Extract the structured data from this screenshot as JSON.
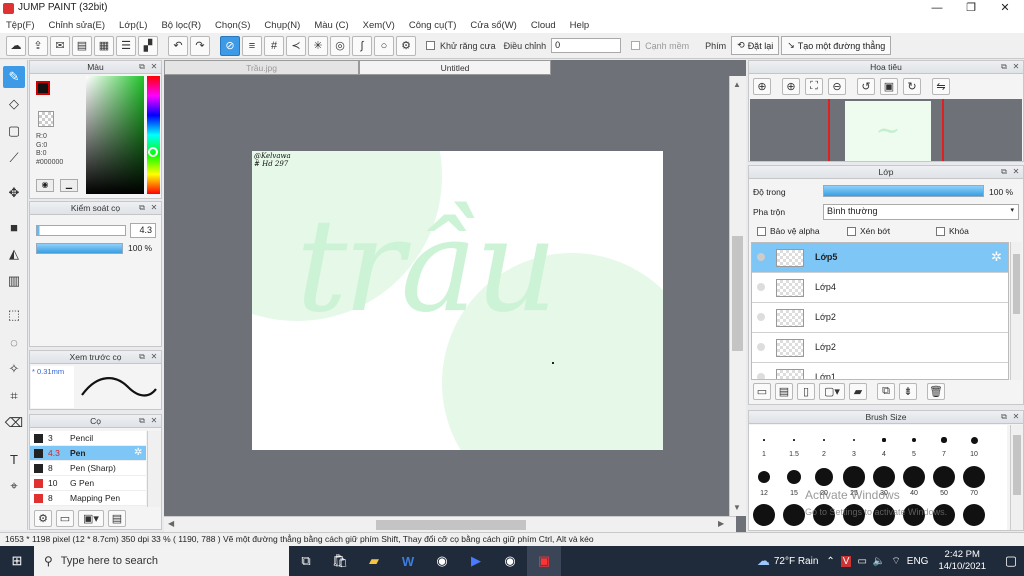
{
  "window": {
    "title": "JUMP PAINT (32bit)",
    "minimize": "—",
    "maximize": "❐",
    "close": "✕"
  },
  "menu": [
    "Tệp(F)",
    "Chỉnh sửa(E)",
    "Lớp(L)",
    "Bộ lọc(R)",
    "Chọn(S)",
    "Chụp(N)",
    "Màu (C)",
    "Xem(V)",
    "Công cụ(T)",
    "Cửa sổ(W)",
    "Cloud",
    "Help"
  ],
  "toolbar": {
    "antialias_label": "Khử răng cưa",
    "adjust_label": "Điều chỉnh",
    "adjust_value": "0",
    "smooth_label": "Cạnh mềm",
    "pen_label": "Phím",
    "reset_label": "Đặt lại",
    "straight_line_label": "Tạo một đường thẳng"
  },
  "color_panel": {
    "title": "Màu",
    "r": "R:0",
    "g": "G:0",
    "b": "B:0",
    "hex": "#000000"
  },
  "brush_control": {
    "title": "Kiểm soát cọ",
    "size": "4.3",
    "opacity": "100 %"
  },
  "preview": {
    "title": "Xem trước cọ",
    "size": "* 0.31mm"
  },
  "brush_panel": {
    "title": "Cọ",
    "items": [
      {
        "size": "3",
        "name": "Pencil",
        "color": "#222222"
      },
      {
        "size": "4.3",
        "name": "Pen",
        "color": "#222222"
      },
      {
        "size": "8",
        "name": "Pen (Sharp)",
        "color": "#222222"
      },
      {
        "size": "10",
        "name": "G Pen",
        "color": "#e03030"
      },
      {
        "size": "8",
        "name": "Mapping Pen",
        "color": "#e03030"
      }
    ]
  },
  "document": {
    "tabs": [
      "Trầu.jpg",
      "Untitled"
    ],
    "canvas_signature_1": "@Kelvawa",
    "canvas_signature_2": "# Hd 297",
    "canvas_text": "trầu"
  },
  "navigator": {
    "title": "Hoa tiêu"
  },
  "layer_panel": {
    "title": "Lớp",
    "opacity_label": "Độ trong",
    "opacity_value": "100 %",
    "blend_label": "Pha trộn",
    "blend_value": "Bình thường",
    "protect_alpha": "Bảo vệ alpha",
    "clipping": "Xén bớt",
    "lock": "Khóa",
    "layers": [
      "Lớp5",
      "Lớp4",
      "Lớp2",
      "Lớp2",
      "Lớp1"
    ]
  },
  "brush_size_panel": {
    "title": "Brush Size",
    "sizes": [
      "1",
      "1.5",
      "2",
      "3",
      "4",
      "5",
      "7",
      "10",
      "12",
      "15",
      "20",
      "25",
      "30",
      "40",
      "50",
      "70"
    ],
    "watermark_1": "Activate Windows",
    "watermark_2": "Go to Settings to activate Windows."
  },
  "status": {
    "text": "1653 * 1198 pixel   (12 * 8.7cm)   350 dpi   33 %   ( 1190, 788 )   Vẽ một đường thẳng bằng cách giữ phím Shift, Thay đổi cỡ cọ bằng cách giữ phím Ctrl, Alt và kéo"
  },
  "taskbar": {
    "search": "Type here to search",
    "weather": "72°F  Rain",
    "lang": "ENG",
    "time": "2:42 PM",
    "date": "14/10/2021"
  }
}
